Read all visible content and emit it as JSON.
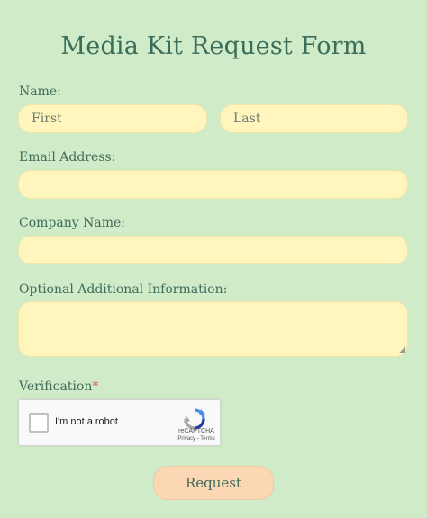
{
  "form": {
    "title": "Media Kit Request Form",
    "name_label": "Name:",
    "first_placeholder": "First",
    "last_placeholder": "Last",
    "email_label": "Email Address:",
    "company_label": "Company Name:",
    "additional_label": "Optional Additional Information:",
    "verification_label": "Verification",
    "required_mark": "*",
    "submit_label": "Request"
  },
  "captcha": {
    "checkbox_label": "I'm not a robot",
    "brand": "reCAPTCHA",
    "links": "Privacy - Terms",
    "icon": "recaptcha-logo"
  },
  "colors": {
    "background": "#d0ebc8",
    "input_fill": "#fff5bd",
    "button_fill": "#fcd7b4",
    "text": "#3f6b5a",
    "required": "#d8553a"
  }
}
